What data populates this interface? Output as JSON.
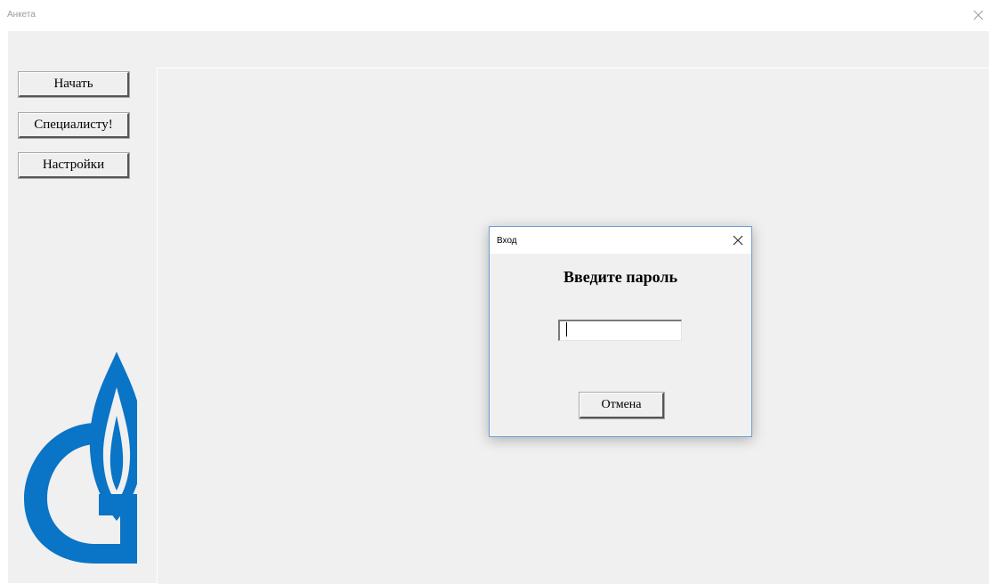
{
  "window": {
    "title": "Анкета",
    "close_icon": "close-icon"
  },
  "sidebar": {
    "buttons": [
      {
        "label": "Начать"
      },
      {
        "label": "Специалисту!"
      },
      {
        "label": "Настройки"
      }
    ],
    "logo": "gazprom-logo"
  },
  "dialog": {
    "title": "Вход",
    "close_icon": "close-icon",
    "heading": "Введите пароль",
    "password_value": "",
    "cancel_label": "Отмена"
  },
  "colors": {
    "logo_blue": "#0a74c6",
    "client_bg": "#f0f0f0",
    "dialog_border": "#6a9fd4"
  }
}
